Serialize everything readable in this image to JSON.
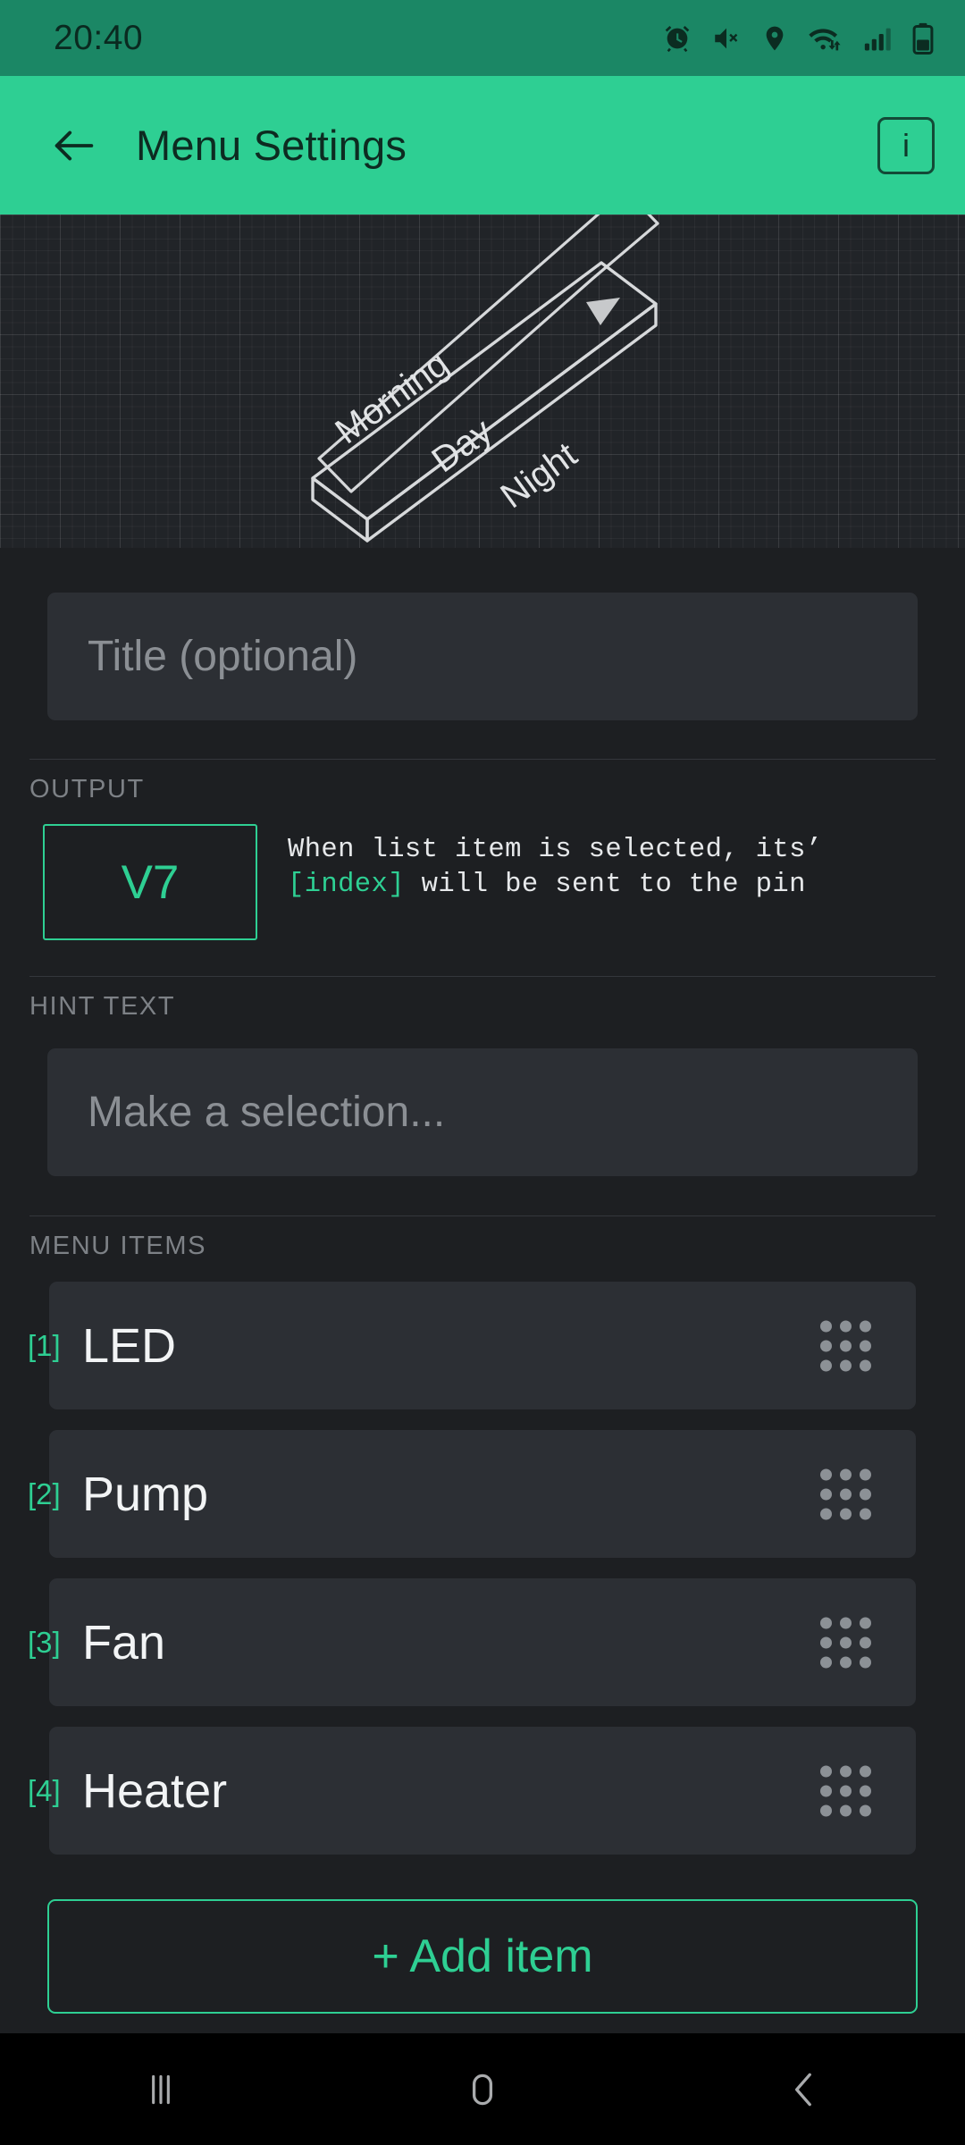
{
  "status_bar": {
    "time": "20:40",
    "icons": [
      "alarm-icon",
      "mute-icon",
      "location-icon",
      "wifi-icon",
      "signal-icon",
      "battery-icon"
    ]
  },
  "app_bar": {
    "back_icon": "back-arrow-icon",
    "title": "Menu Settings",
    "info_label": "i"
  },
  "preview": {
    "widget_labels": [
      "Morning",
      "Day",
      "Night"
    ],
    "arrow_icon": "dropdown-triangle-icon"
  },
  "title_field": {
    "value": "",
    "placeholder": "Title (optional)"
  },
  "output": {
    "section_label": "OUTPUT",
    "pin": "V7",
    "description_part1": "When list item is selected, its’ ",
    "description_token": "[index]",
    "description_part2": " will be sent to the pin"
  },
  "hint_text": {
    "section_label": "HINT TEXT",
    "value": "",
    "placeholder": "Make a selection..."
  },
  "menu_items": {
    "section_label": "MENU ITEMS",
    "items": [
      {
        "index": "[1]",
        "name": "LED",
        "handle": "drag-handle-icon"
      },
      {
        "index": "[2]",
        "name": "Pump",
        "handle": "drag-handle-icon"
      },
      {
        "index": "[3]",
        "name": "Fan",
        "handle": "drag-handle-icon"
      },
      {
        "index": "[4]",
        "name": "Heater",
        "handle": "drag-handle-icon"
      }
    ],
    "add_label": "+ Add item"
  },
  "nav_bar": {
    "recents": "recents-icon",
    "home": "home-icon",
    "back": "back-icon"
  },
  "colors": {
    "accent_green": "#2ecf93",
    "statusbar_green": "#1b8765",
    "page_bg": "#1d1f22",
    "card_bg": "#2c2f34"
  }
}
